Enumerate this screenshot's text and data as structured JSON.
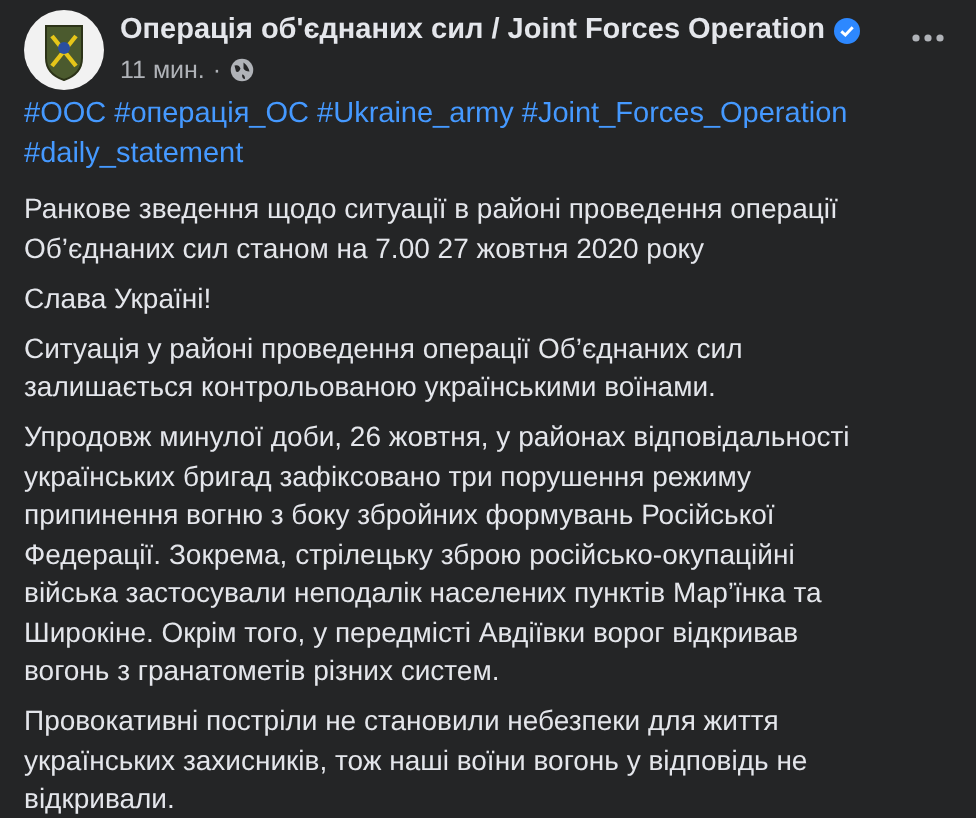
{
  "post": {
    "author": "Операція об'єднаних сил / Joint Forces Operation",
    "verified": true,
    "time": "11 мин.",
    "separator": "·",
    "hashtags": [
      [
        "#ООС",
        "#операція_ОС",
        "#Ukraine_army",
        "#Joint_Forces_Operation"
      ],
      [
        "#daily_statement"
      ]
    ],
    "paragraphs": [
      {
        "lines": [
          "Ранкове зведення щодо ситуації в районі проведення операції",
          "Об’єднаних сил станом на 7.00 27 жовтня 2020 року"
        ]
      },
      {
        "lines": [
          "Слава Україні!"
        ]
      },
      {
        "lines": [
          "Ситуація у районі проведення операції Об’єднаних сил",
          "залишається контрольованою українськими воїнами."
        ]
      },
      {
        "lines": [
          "Упродовж минулої доби, 26 жовтня, у районах відповідальності",
          "українських бригад зафіксовано три порушення режиму",
          "припинення вогню з боку збройних формувань Російської",
          "Федерації. Зокрема, стрілецьку зброю російсько-окупаційні",
          "війська застосували неподалік населених пунктів Мар’їнка та",
          "Широкіне. Окрім того, у передмісті Авдіївки ворог відкривав",
          "вогонь з гранатометів різних систем."
        ]
      },
      {
        "lines": [
          "Провокативні постріли не становили небезпеки для життя",
          "українських захисників, тож наші воїни вогонь у відповідь не",
          "відкривали."
        ]
      }
    ]
  }
}
